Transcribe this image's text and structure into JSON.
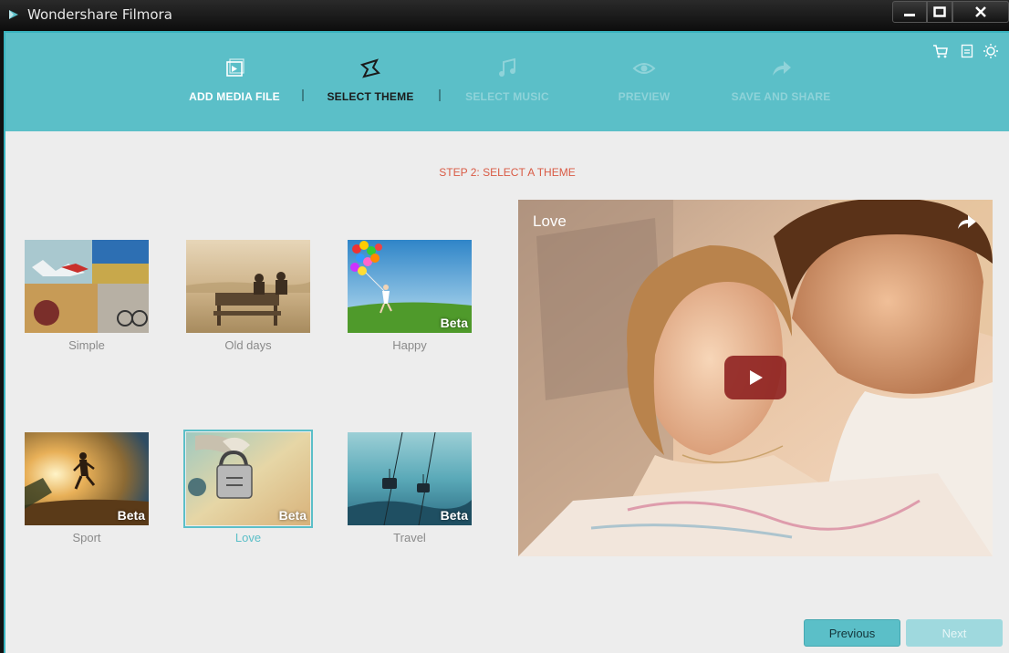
{
  "window": {
    "title": "Wondershare Filmora"
  },
  "steps": [
    {
      "label": "ADD MEDIA FILE",
      "icon": "media-file-icon",
      "state": "done"
    },
    {
      "label": "SELECT THEME",
      "icon": "theme-icon",
      "state": "active"
    },
    {
      "label": "SELECT MUSIC",
      "icon": "music-note-icon",
      "state": "disabled"
    },
    {
      "label": "PREVIEW",
      "icon": "eye-icon",
      "state": "disabled"
    },
    {
      "label": "SAVE AND SHARE",
      "icon": "share-arrow-icon",
      "state": "disabled"
    }
  ],
  "header_icons": [
    "cart-icon",
    "register-icon",
    "brightness-icon"
  ],
  "step_heading": "STEP 2: SELECT A THEME",
  "themes": [
    {
      "name": "Simple",
      "beta": ""
    },
    {
      "name": "Old days",
      "beta": ""
    },
    {
      "name": "Happy",
      "beta": "Beta"
    },
    {
      "name": "Sport",
      "beta": "Beta"
    },
    {
      "name": "Love",
      "beta": "Beta",
      "selected": true
    },
    {
      "name": "Travel",
      "beta": "Beta"
    }
  ],
  "preview": {
    "title": "Love"
  },
  "buttons": {
    "previous": "Previous",
    "next": "Next"
  },
  "colors": {
    "accent": "#5bbfc8",
    "step_heading": "#d95b45",
    "play_button": "#8c1e1e"
  }
}
